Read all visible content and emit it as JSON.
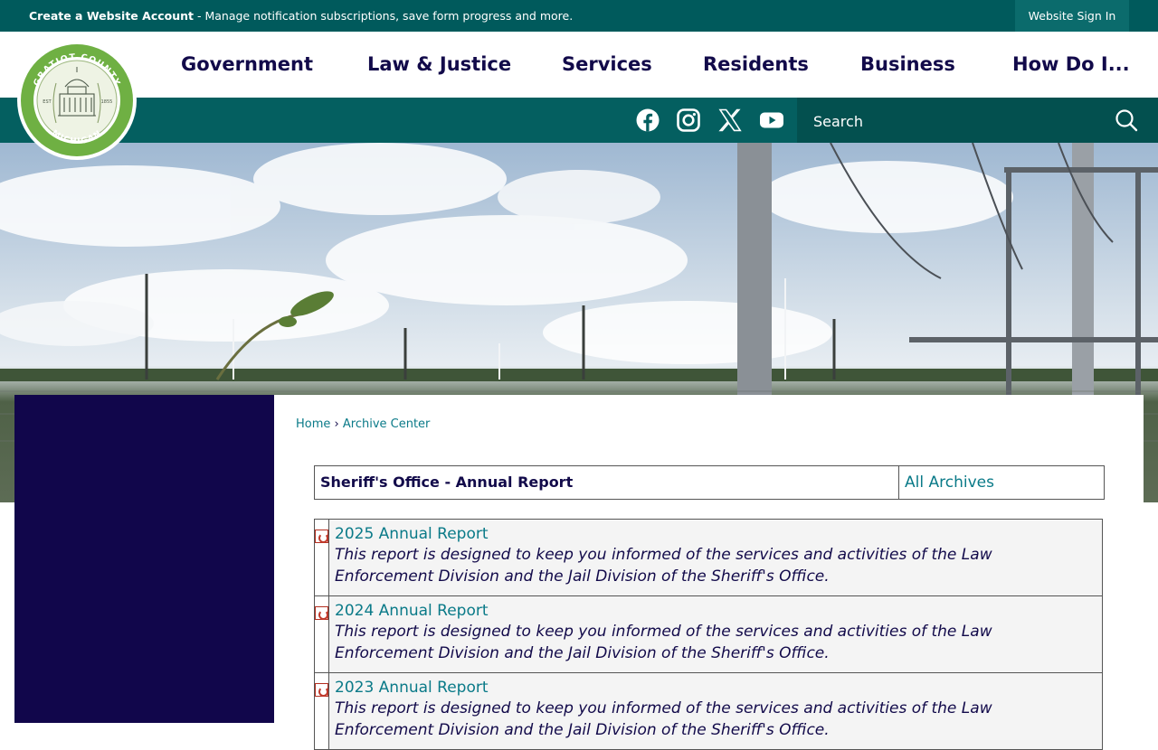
{
  "topbar": {
    "account_link": "Create a Website Account",
    "account_msg": " - Manage notification subscriptions, save form progress and more.",
    "sign_in": "Website Sign In"
  },
  "logo": {
    "text_top": "GRATIOT COUNTY",
    "text_bottom": "MICHIGAN",
    "est": "EST",
    "year": "1855"
  },
  "nav": {
    "items": [
      "Government",
      "Law & Justice",
      "Services",
      "Residents",
      "Business",
      "How Do I..."
    ]
  },
  "social": [
    "facebook-icon",
    "instagram-icon",
    "x-icon",
    "youtube-icon"
  ],
  "search": {
    "placeholder": "Search"
  },
  "breadcrumb": {
    "home": "Home",
    "separator": "›",
    "current": "Archive Center"
  },
  "archive": {
    "title": "Sheriff's Office - Annual Report",
    "all_link": "All Archives",
    "items": [
      {
        "title": "2025 Annual Report",
        "desc": "This report is designed to keep you informed of the services and activities of the Law Enforcement Division and the Jail Division of the Sheriff's Office."
      },
      {
        "title": "2024 Annual Report",
        "desc": "This report is designed to keep you informed of the services and activities of the Law Enforcement Division and the Jail Division of the Sheriff's Office."
      },
      {
        "title": "2023 Annual Report",
        "desc": "This report is designed to keep you informed of the services and activities of the Law Enforcement Division and the Jail Division of the Sheriff's Office."
      }
    ]
  },
  "colors": {
    "teal_dark": "#005a5c",
    "teal_band": "#045f60",
    "navy": "#120a4a",
    "link": "#0a7a88"
  }
}
